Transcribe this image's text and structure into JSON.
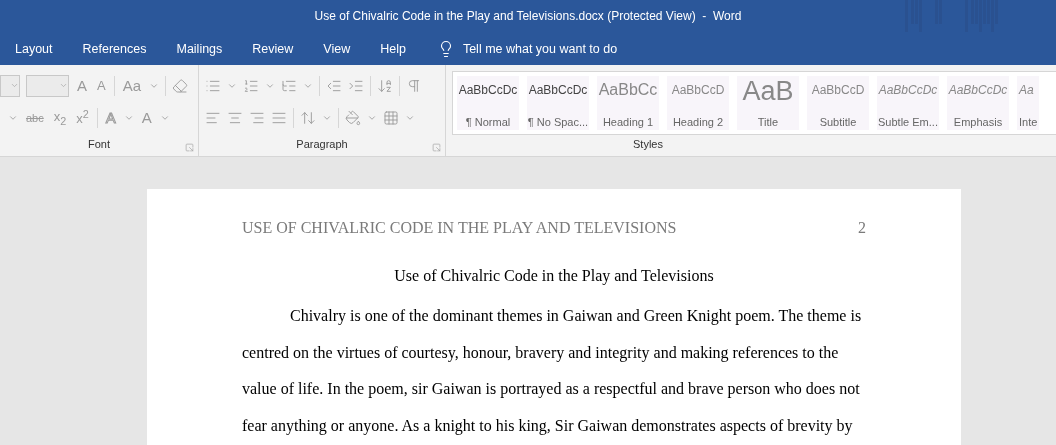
{
  "window": {
    "title": "Use of Chivalric Code in the Play and Televisions.docx (Protected View)  -  Word"
  },
  "tabs": [
    {
      "label": "Layout",
      "selected": false
    },
    {
      "label": "References",
      "selected": false
    },
    {
      "label": "Mailings",
      "selected": false
    },
    {
      "label": "Review",
      "selected": false
    },
    {
      "label": "View",
      "selected": false
    },
    {
      "label": "Help",
      "selected": false
    }
  ],
  "tell_me": {
    "placeholder": "Tell me what you want to do"
  },
  "font_group": {
    "label": "Font",
    "row1": [
      "A",
      "A",
      "Aa"
    ],
    "row2": [
      "abc",
      "x$_{2}$",
      "x$^{2}$",
      "A",
      "A"
    ]
  },
  "paragraph_group": {
    "label": "Paragraph"
  },
  "styles_group": {
    "label": "Styles",
    "items": [
      {
        "sample": "AaBbCcDc",
        "name": "¶ Normal",
        "kind": "normal"
      },
      {
        "sample": "AaBbCcDc",
        "name": "¶ No Spac...",
        "kind": "normal"
      },
      {
        "sample": "AaBbCc",
        "name": "Heading 1",
        "kind": "heading1"
      },
      {
        "sample": "AaBbCcD",
        "name": "Heading 2",
        "kind": "heading2"
      },
      {
        "sample": "AaB",
        "name": "Title",
        "kind": "title"
      },
      {
        "sample": "AaBbCcD",
        "name": "Subtitle",
        "kind": "subtitle"
      },
      {
        "sample": "AaBbCcDc",
        "name": "Subtle Em...",
        "kind": "italic"
      },
      {
        "sample": "AaBbCcDc",
        "name": "Emphasis",
        "kind": "italic"
      },
      {
        "sample": "Aa",
        "name": "Inte",
        "kind": "italic"
      }
    ]
  },
  "document": {
    "header": "USE OF CHIVALRIC CODE IN THE PLAY AND TELEVISIONS",
    "page_number": "2",
    "title": "Use of Chivalric Code in the Play and Televisions",
    "paragraph": "Chivalry is one of the dominant themes in Gaiwan and Green Knight poem. The theme is centred on the virtues of courtesy, honour, bravery and integrity and making references to the value of life. In the poem, sir Gaiwan is portrayed as a respectful and brave person who does not fear anything or anyone. As a knight to his king, Sir Gaiwan demonstrates aspects of brevity by"
  }
}
